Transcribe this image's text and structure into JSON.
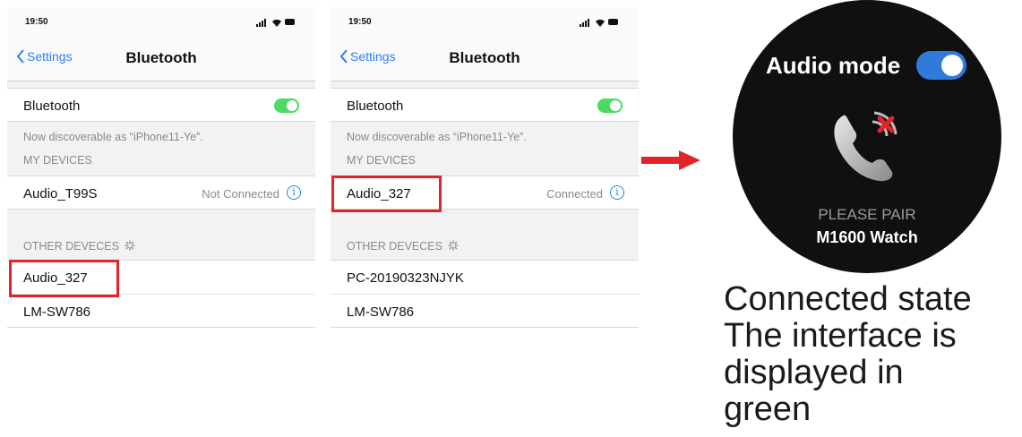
{
  "phone1": {
    "time": "19:50",
    "back_label": "Settings",
    "title": "Bluetooth",
    "bluetooth_label": "Bluetooth",
    "discoverable": "Now discoverable as “iPhone11-Ye”.",
    "my_devices_header": "MY DEVICES",
    "my_devices": [
      {
        "name": "Audio_T99S",
        "status": "Not Connected"
      }
    ],
    "other_devices_header": "OTHER DEVECES",
    "other_devices": [
      "Audio_327",
      "LM-SW786"
    ],
    "highlight": "Audio_327"
  },
  "phone2": {
    "time": "19:50",
    "back_label": "Settings",
    "title": "Bluetooth",
    "bluetooth_label": "Bluetooth",
    "discoverable": "Now discoverable as “iPhone11-Ye”.",
    "my_devices_header": "MY DEVICES",
    "my_devices": [
      {
        "name": "Audio_327",
        "status": "Connected"
      }
    ],
    "other_devices_header": "OTHER DEVECES",
    "other_devices": [
      "PC-20190323NJYK",
      "LM-SW786"
    ],
    "highlight": "Audio_327"
  },
  "watch": {
    "audio_mode_label": "Audio mode",
    "audio_mode_on": true,
    "pair_line1": "PLEASE PAIR",
    "pair_line2": "M1600 Watch"
  },
  "caption": {
    "line1": "Connected state",
    "line2": "The interface is",
    "line3": "displayed in",
    "line4": "green"
  },
  "colors": {
    "ios_blue": "#2d7df6",
    "toggle_green": "#4cd964",
    "highlight_red": "#e2232a",
    "watch_toggle_blue": "#2f7bd9"
  },
  "icons": [
    "signal-icon",
    "wifi-icon",
    "battery-icon",
    "chevron-left-icon",
    "info-icon",
    "spinner-icon",
    "arrow-right-icon",
    "phone-disconnected-icon"
  ]
}
